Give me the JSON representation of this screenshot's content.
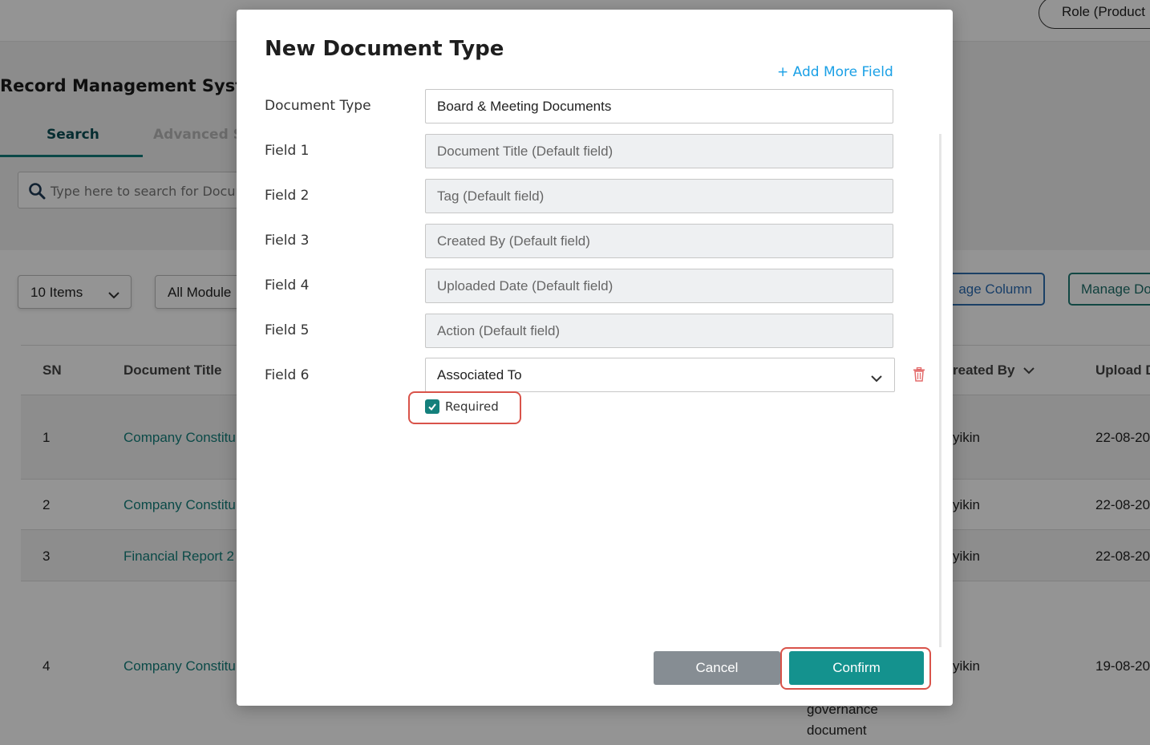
{
  "background": {
    "role_button": "Role (Product",
    "app_title": "Record Management Syst",
    "tabs": {
      "search": "Search",
      "advanced": "Advanced S"
    },
    "search_placeholder": "Type here to search for Docur",
    "items_select": "10 Items",
    "module_select": "All Module",
    "manage_column": "age Column",
    "manage_doc": "Manage Do",
    "table": {
      "headers": {
        "sn": "SN",
        "doc_title": "Document Title",
        "created_by": "reated By",
        "upload": "Upload D"
      },
      "rows": [
        {
          "sn": "1",
          "title": "Company Constitu",
          "created": "yikin",
          "date": "22-08-20"
        },
        {
          "sn": "2",
          "title": "Company Constitu",
          "created": "yikin",
          "date": "22-08-20"
        },
        {
          "sn": "3",
          "title": "Financial Report 2",
          "created": "yikin",
          "date": "22-08-20"
        },
        {
          "sn": "4",
          "title": "Company Constitu",
          "created": "yikin",
          "date": "19-08-20"
        }
      ],
      "tag_text_1": "governance",
      "tag_text_2": "document"
    }
  },
  "modal": {
    "title": "New Document Type",
    "add_more_field": "+ Add More Field",
    "document_type_label": "Document Type",
    "document_type_value": "Board & Meeting Documents",
    "fields": [
      {
        "label": "Field 1",
        "value": "Document Title (Default field)"
      },
      {
        "label": "Field 2",
        "value": "Tag (Default field)"
      },
      {
        "label": "Field 3",
        "value": "Created By (Default field)"
      },
      {
        "label": "Field 4",
        "value": "Uploaded Date (Default field)"
      },
      {
        "label": "Field 5",
        "value": "Action (Default field)"
      }
    ],
    "field6": {
      "label": "Field 6",
      "value": "Associated To"
    },
    "required_label": "Required",
    "required_checked": true,
    "cancel": "Cancel",
    "confirm": "Confirm"
  },
  "colors": {
    "accent": "#14928e",
    "link": "#1aa0e6",
    "highlight": "#d9534a"
  }
}
